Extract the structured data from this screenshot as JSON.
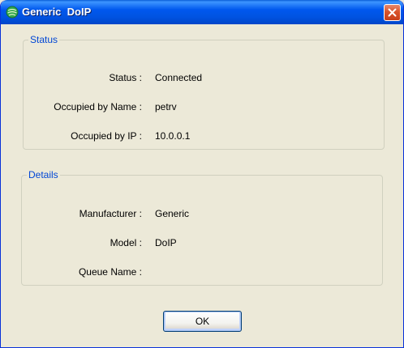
{
  "window": {
    "title": "Generic  DoIP"
  },
  "status_group": {
    "legend": "Status",
    "rows": [
      {
        "label": "Status :",
        "value": "Connected"
      },
      {
        "label": "Occupied by Name :",
        "value": "petrv"
      },
      {
        "label": "Occupied by IP :",
        "value": "10.0.0.1"
      }
    ]
  },
  "details_group": {
    "legend": "Details",
    "rows": [
      {
        "label": "Manufacturer :",
        "value": "Generic"
      },
      {
        "label": "Model :",
        "value": "DoIP"
      },
      {
        "label": "Queue Name :",
        "value": ""
      }
    ]
  },
  "buttons": {
    "ok_label": "OK"
  },
  "colors": {
    "titlebar": "#0058ee",
    "legend": "#0046d5",
    "background": "#ece9d8",
    "close": "#d9542c"
  }
}
